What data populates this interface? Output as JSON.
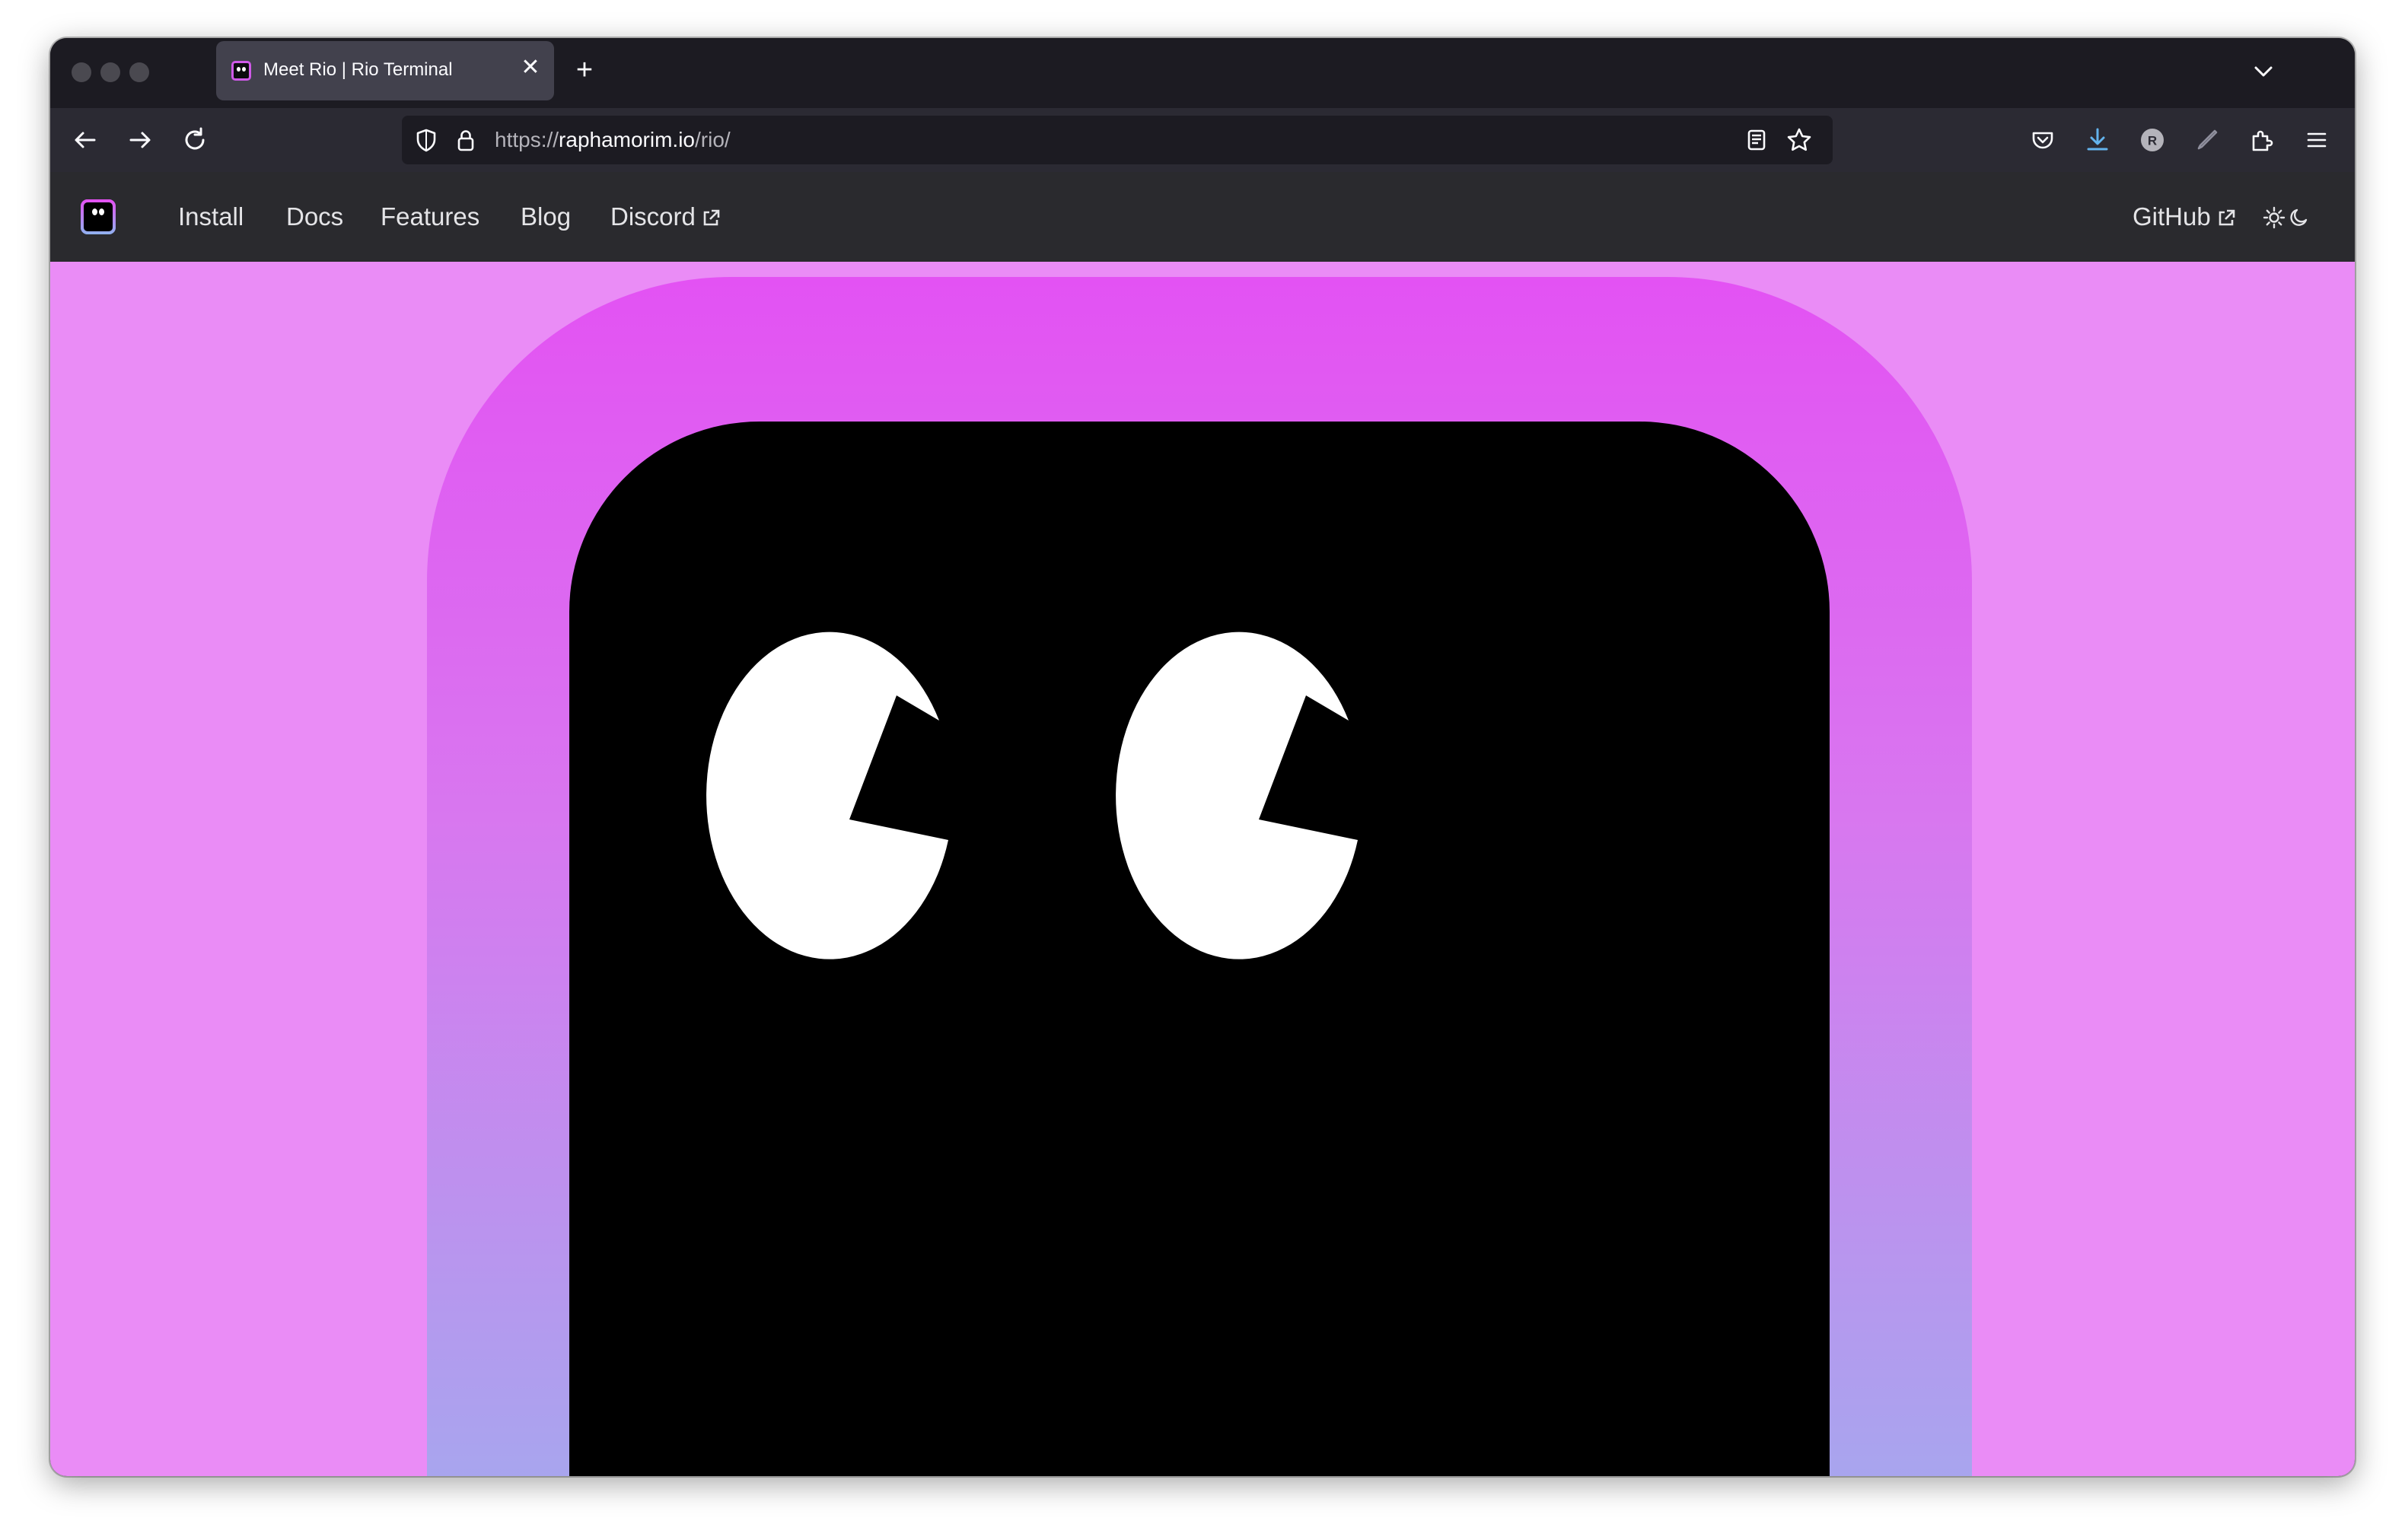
{
  "browser": {
    "tab_title": "Meet Rio | Rio Terminal",
    "tab_close": "✕",
    "new_tab": "+",
    "url_scheme": "https://",
    "url_host": "raphamorim.io",
    "url_path": "/rio/",
    "profile_initial": "R"
  },
  "site": {
    "nav": {
      "install": "Install",
      "docs": "Docs",
      "features": "Features",
      "blog": "Blog",
      "discord": "Discord",
      "github": "GitHub"
    }
  },
  "colors": {
    "hero_background": "#ea8cf6",
    "outer_frame_top": "#e352f3",
    "outer_frame_bottom": "#a8a5ee",
    "face": "#000000",
    "eye": "#ffffff",
    "nav_background": "#2a2a2e"
  },
  "icons": [
    "back-arrow-icon",
    "forward-arrow-icon",
    "reload-icon",
    "shield-icon",
    "lock-icon",
    "reader-view-icon",
    "bookmark-star-icon",
    "pocket-icon",
    "download-icon",
    "account-icon",
    "pen-icon",
    "extensions-icon",
    "menu-icon",
    "external-link-icon",
    "sun-icon",
    "moon-icon",
    "rio-logo"
  ]
}
